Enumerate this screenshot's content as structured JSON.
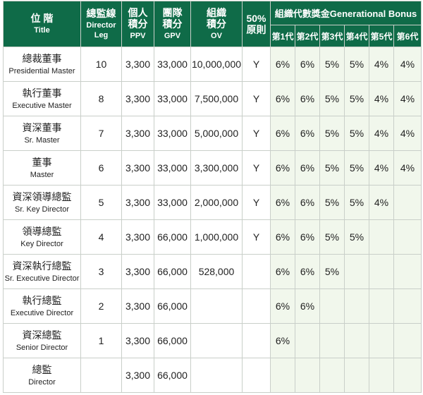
{
  "header": {
    "title_zh": "位 階",
    "title_en": "Title",
    "leg_zh": "總監線",
    "leg_en1": "Director",
    "leg_en2": "Leg",
    "ppv_zh1": "個人",
    "ppv_zh2": "積分",
    "ppv_en": "PPV",
    "gpv_zh1": "團隊",
    "gpv_zh2": "積分",
    "gpv_en": "GPV",
    "ov_zh1": "組織",
    "ov_zh2": "積分",
    "ov_en": "OV",
    "rule_1": "50%",
    "rule_2": "原則",
    "generational_bonus": "組織代數獎金Generational Bonus",
    "generations": [
      "第1代",
      "第2代",
      "第3代",
      "第4代",
      "第5代",
      "第6代"
    ]
  },
  "rows": [
    {
      "title_zh": "總裁董事",
      "title_en": "Presidential Master",
      "leg": "10",
      "ppv": "3,300",
      "gpv": "33,000",
      "ov": "10,000,000",
      "rule": "Y",
      "bonus": [
        "6%",
        "6%",
        "5%",
        "5%",
        "4%",
        "4%"
      ]
    },
    {
      "title_zh": "執行董事",
      "title_en": "Executive Master",
      "leg": "8",
      "ppv": "3,300",
      "gpv": "33,000",
      "ov": "7,500,000",
      "rule": "Y",
      "bonus": [
        "6%",
        "6%",
        "5%",
        "5%",
        "4%",
        "4%"
      ]
    },
    {
      "title_zh": "資深董事",
      "title_en": "Sr. Master",
      "leg": "7",
      "ppv": "3,300",
      "gpv": "33,000",
      "ov": "5,000,000",
      "rule": "Y",
      "bonus": [
        "6%",
        "6%",
        "5%",
        "5%",
        "4%",
        "4%"
      ]
    },
    {
      "title_zh": "董事",
      "title_en": "Master",
      "leg": "6",
      "ppv": "3,300",
      "gpv": "33,000",
      "ov": "3,300,000",
      "rule": "Y",
      "bonus": [
        "6%",
        "6%",
        "5%",
        "5%",
        "4%",
        "4%"
      ]
    },
    {
      "title_zh": "資深領導總監",
      "title_en": "Sr. Key Director",
      "leg": "5",
      "ppv": "3,300",
      "gpv": "33,000",
      "ov": "2,000,000",
      "rule": "Y",
      "bonus": [
        "6%",
        "6%",
        "5%",
        "5%",
        "4%",
        ""
      ]
    },
    {
      "title_zh": "領導總監",
      "title_en": "Key Director",
      "leg": "4",
      "ppv": "3,300",
      "gpv": "66,000",
      "ov": "1,000,000",
      "rule": "Y",
      "bonus": [
        "6%",
        "6%",
        "5%",
        "5%",
        "",
        ""
      ]
    },
    {
      "title_zh": "資深執行總監",
      "title_en": "Sr. Executive Director",
      "leg": "3",
      "ppv": "3,300",
      "gpv": "66,000",
      "ov": "528,000",
      "rule": "",
      "bonus": [
        "6%",
        "6%",
        "5%",
        "",
        "",
        ""
      ]
    },
    {
      "title_zh": "執行總監",
      "title_en": "Executive Director",
      "leg": "2",
      "ppv": "3,300",
      "gpv": "66,000",
      "ov": "",
      "rule": "",
      "bonus": [
        "6%",
        "6%",
        "",
        "",
        "",
        ""
      ]
    },
    {
      "title_zh": "資深總監",
      "title_en": "Senior Director",
      "leg": "1",
      "ppv": "3,300",
      "gpv": "66,000",
      "ov": "",
      "rule": "",
      "bonus": [
        "6%",
        "",
        "",
        "",
        "",
        ""
      ]
    },
    {
      "title_zh": "總監",
      "title_en": "Director",
      "leg": "",
      "ppv": "3,300",
      "gpv": "66,000",
      "ov": "",
      "rule": "",
      "bonus": [
        "",
        "",
        "",
        "",
        "",
        ""
      ]
    }
  ],
  "colors": {
    "header_bg": "#0f6b48",
    "bonus_cell_bg": "#f1f7ec",
    "border": "#c9cfc9"
  }
}
